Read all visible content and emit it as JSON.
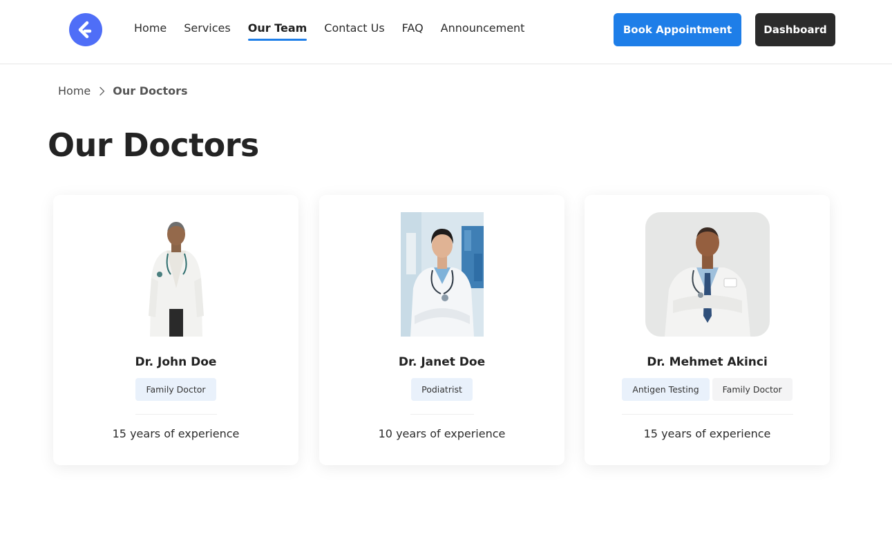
{
  "header": {
    "logo_icon": "brand-logo-icon",
    "accent_color": "#1e7ee8",
    "nav": [
      {
        "label": "Home",
        "active": false
      },
      {
        "label": "Services",
        "active": false
      },
      {
        "label": "Our Team",
        "active": true
      },
      {
        "label": "Contact Us",
        "active": false
      },
      {
        "label": "FAQ",
        "active": false
      },
      {
        "label": "Announcement",
        "active": false
      }
    ],
    "book_label": "Book Appointment",
    "dashboard_label": "Dashboard"
  },
  "breadcrumb": {
    "home": "Home",
    "current": "Our Doctors"
  },
  "page_title": "Our Doctors",
  "doctors": [
    {
      "name": "Dr. John Doe",
      "tags": [
        "Family Doctor"
      ],
      "experience": "15 years of experience"
    },
    {
      "name": "Dr. Janet Doe",
      "tags": [
        "Podiatrist"
      ],
      "experience": "10 years of experience"
    },
    {
      "name": "Dr. Mehmet Akinci",
      "tags": [
        "Antigen Testing",
        "Family Doctor"
      ],
      "experience": "15 years of experience"
    }
  ]
}
